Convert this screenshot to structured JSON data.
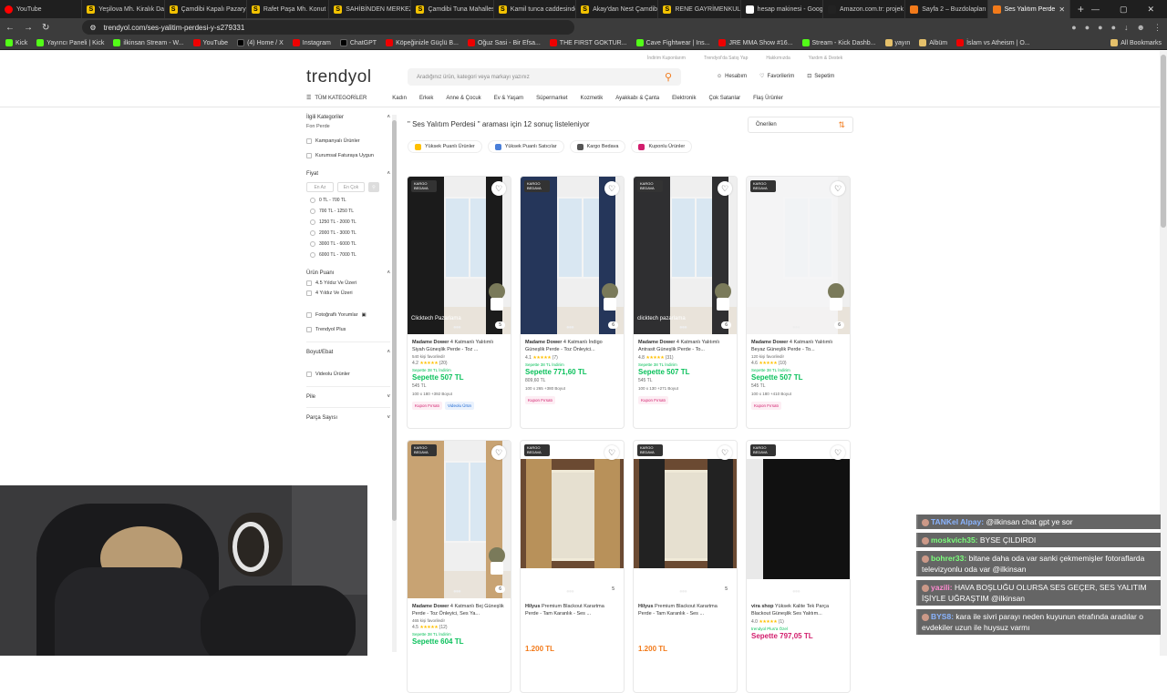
{
  "browser": {
    "tabs": [
      {
        "label": "YouTube",
        "type": "yt"
      },
      {
        "label": "Yeşilova Mh. Kiralık Daire",
        "type": "s"
      },
      {
        "label": "Çamdibi Kapalı Pazaryeri",
        "type": "s"
      },
      {
        "label": "Rafet Paşa Mh. Konut Fiy",
        "type": "s"
      },
      {
        "label": "SAHİBİNDEN MERKEZİ F",
        "type": "s"
      },
      {
        "label": "Çamdibi Tuna Mahallesi",
        "type": "s"
      },
      {
        "label": "Kamil tunca caddesinde",
        "type": "s"
      },
      {
        "label": "Akay'dan Nest Çamdibi",
        "type": "s"
      },
      {
        "label": "RENE GAYRİMENKULDE",
        "type": "s"
      },
      {
        "label": "hesap makinesi - Google",
        "type": "g"
      },
      {
        "label": "Amazon.com.tr: projek",
        "type": "a"
      },
      {
        "label": "Sayfa 2 – Buzdolapları",
        "type": "t"
      },
      {
        "label": "Ses Yalıtım Perde",
        "type": "t",
        "active": true
      }
    ],
    "url": "trendyol.com/ses-yalitim-perdesi-y-s279331",
    "bookmarks": [
      {
        "label": "Kick",
        "icon": "green"
      },
      {
        "label": "Yayıncı Paneli | Kick",
        "icon": "green"
      },
      {
        "label": "ilkinsan Stream - W...",
        "icon": "green"
      },
      {
        "label": "YouTube",
        "icon": "red"
      },
      {
        "label": "(4) Home / X",
        "icon": "x"
      },
      {
        "label": "Instagram",
        "icon": "red"
      },
      {
        "label": "ChatGPT",
        "icon": "x"
      },
      {
        "label": "Köpeğinizle Güçlü B...",
        "icon": "red"
      },
      {
        "label": "Oğuz Sasi - Bir Efsa...",
        "icon": "red"
      },
      {
        "label": "THE FIRST GOKTUR...",
        "icon": "red"
      },
      {
        "label": "Cave Fightwear | Ins...",
        "icon": "green"
      },
      {
        "label": "JRE MMA Show #16...",
        "icon": "red"
      },
      {
        "label": "Stream - Kick Dashb...",
        "icon": "green"
      },
      {
        "label": "yayın",
        "icon": "folder"
      },
      {
        "label": "Albüm",
        "icon": "folder"
      },
      {
        "label": "İslam vs Atheism | O...",
        "icon": "red"
      },
      {
        "label": "All Bookmarks",
        "icon": "folder"
      }
    ]
  },
  "site": {
    "logo": "trendyol",
    "top_links": [
      "İndirim Kuponlarım",
      "Trendyol'da Satış Yap",
      "Hakkımızda",
      "Yardım & Destek"
    ],
    "search_placeholder": "Aradığınız ürün, kategori veya markayı yazınız",
    "user_actions": [
      "Hesabım",
      "Favorilerim",
      "Sepetim"
    ],
    "all_categories": "TÜM KATEGORİLER",
    "categories": [
      "Kadın",
      "Erkek",
      "Anne & Çocuk",
      "Ev & Yaşam",
      "Süpermarket",
      "Kozmetik",
      "Ayakkabı & Çanta",
      "Elektronik",
      "Çok Satanlar",
      "Flaş Ürünler"
    ]
  },
  "filters": {
    "related_title": "İlgili Kategoriler",
    "related_item": "Fon Perde",
    "campaign": "Kampanyalı Ürünler",
    "corporate": "Kurumsal Faturaya Uygun",
    "price_title": "Fiyat",
    "min_placeholder": "En Az",
    "max_placeholder": "En Çok",
    "price_ranges": [
      "0 TL - 700 TL",
      "700 TL - 1250 TL",
      "1250 TL - 2000 TL",
      "2000 TL - 3000 TL",
      "3000 TL - 6000 TL",
      "6000 TL - 7000 TL"
    ],
    "rating_title": "Ürün Puanı",
    "rating_options": [
      "4.5 Yıldız Ve Üzeri",
      "4 Yıldız Ve Üzeri"
    ],
    "photo_reviews": "Fotoğraflı Yorumlar",
    "trendyol_plus": "Trendyol Plus",
    "size_title": "Boyut/Ebat",
    "video_products": "Videolu Ürünler",
    "pile": "Pile",
    "piece_count": "Parça Sayısı"
  },
  "results": {
    "text": "\" Ses Yalıtım Perdesi \" araması için 12 sonuç listeleniyor",
    "sort_label": "Önerilen",
    "chips": [
      {
        "label": "Yüksek Puanlı Ürünler",
        "color": "#ffc000"
      },
      {
        "label": "Yüksek Puanlı Satıcılar",
        "color": "#4a7fd9"
      },
      {
        "label": "Kargo Bedava",
        "color": "#555555"
      },
      {
        "label": "Kuponlu Ürünler",
        "color": "#d21e6d"
      }
    ]
  },
  "products": [
    {
      "badge": "KARGO BEDAVA",
      "brand": "Madame Dower",
      "name": "4 Katmanlı Yalıtımlı Siyah Güneşlik Perde - Toz ...",
      "fav": "540 kişi favoriledi!",
      "rating": "4.2",
      "reviews": "(20)",
      "promo": "Sepette 38 TL İndirim",
      "price": "Sepette 507 TL",
      "old": "545 TL",
      "size": "100 x 180 +392 Boyut",
      "tags": [
        "Kupon Fırsatı",
        "Videolu Ürün"
      ],
      "curtain": "#1b1b1b",
      "wm": "Clicktech Pazarlama",
      "photos": "5",
      "price_color": "green"
    },
    {
      "badge": "KARGO BEDAVA",
      "brand": "Madame Dower",
      "name": "4 Katmanlı İndigo Güneşlik Perde - Toz Önleyici...",
      "fav": "",
      "rating": "4.1",
      "reviews": "(7)",
      "promo": "Sepette 38 TL İndirim",
      "price": "Sepette 771,60 TL",
      "old": "809,60 TL",
      "size": "100 x 265 +380 Boyut",
      "tags": [
        "Kupon Fırsatı"
      ],
      "curtain": "#25365a",
      "wm": "",
      "photos": "6",
      "price_color": "green"
    },
    {
      "badge": "KARGO BEDAVA",
      "brand": "Madame Dower",
      "name": "4 Katmanlı Yalıtımlı Antrasit Güneşlik Perde - To...",
      "fav": "",
      "rating": "4.8",
      "reviews": "(31)",
      "promo": "Sepette 38 TL İndirim",
      "price": "Sepette 507 TL",
      "old": "545 TL",
      "size": "100 x 130 +271 Boyut",
      "tags": [
        "Kupon Fırsatı"
      ],
      "curtain": "#2f2f31",
      "wm": "clicktech pazarlama",
      "photos": "6",
      "price_color": "green"
    },
    {
      "badge": "KARGO BEDAVA",
      "brand": "Madame Dower",
      "name": "4 Katmanlı Yalıtımlı Beyaz Güneşlik Perde - To...",
      "fav": "120 kişi favoriledi!",
      "rating": "4.6",
      "reviews": "(10)",
      "promo": "Sepette 38 TL İndirim",
      "price": "Sepette 507 TL",
      "old": "545 TL",
      "size": "100 x 180 +410 Boyut",
      "tags": [
        "Kupon Fırsatı"
      ],
      "curtain": "#f4f4f6",
      "wm": "",
      "photos": "6",
      "price_color": "green"
    },
    {
      "badge": "KARGO BEDAVA",
      "brand": "Madame Dower",
      "name": "4 Katmanlı Bej Güneşlik Perde - Toz Önleyici, Ses Ya...",
      "fav": "465 kişi favoriledi!",
      "rating": "4.5",
      "reviews": "(12)",
      "promo": "Sepette 38 TL İndirim",
      "price": "Sepette 604 TL",
      "old": "",
      "size": "",
      "tags": [],
      "curtain": "#c8a373",
      "wm": "",
      "photos": "6",
      "price_color": "green"
    },
    {
      "badge": "KARGO BEDAVA",
      "brand": "Hilyus",
      "name": "Premium Blackout Karartma Perde - Tam Karanlık - Ses ...",
      "fav": "",
      "rating": "",
      "reviews": "",
      "promo": "",
      "price": "1.200 TL",
      "old": "",
      "size": "",
      "tags": [],
      "curtain": "#b8915a",
      "wm": "",
      "photos": "5",
      "price_color": "orange"
    },
    {
      "badge": "KARGO BEDAVA",
      "brand": "Hilyus",
      "name": "Premium Blackout Karartma Perde - Tam Karanlık - Ses ...",
      "fav": "",
      "rating": "",
      "reviews": "",
      "promo": "",
      "price": "1.200 TL",
      "old": "",
      "size": "",
      "tags": [],
      "curtain": "#222222",
      "wm": "",
      "photos": "5",
      "price_color": "orange"
    },
    {
      "badge": "KARGO BEDAVA",
      "brand": "vira shop",
      "name": "Yüksek Kalite Tek Parça Blackout Güneşlik Ses Yalıtım...",
      "fav": "",
      "rating": "4.0",
      "reviews": "(1)",
      "promo": "trendyol Plus'a Özel",
      "price": "Sepette 797,05 TL",
      "old": "",
      "size": "",
      "tags": [],
      "curtain": "#111111",
      "wm": "",
      "photos": "",
      "price_color": "pink"
    }
  ],
  "chat": [
    {
      "user": "TANKel Alpay:",
      "text": "@ilkinsan chat gpt ye sor",
      "color": "#8ab4ff"
    },
    {
      "user": "moskvich35:",
      "text": "BYSE ÇILDIRDI",
      "color": "#7cff7c"
    },
    {
      "user": "bohrer33:",
      "text": "bitane daha oda var sanki çekmemişler fotoraflarda televizyonlu oda var @ilkinsan",
      "color": "#7cff7c"
    },
    {
      "user": "yazili:",
      "text": "HAVA BOŞLUĞU OLURSA SES GEÇER, SES YALITIM İŞİYLE UĞRAŞTIM @ilkinsan",
      "color": "#ff8ad0"
    },
    {
      "user": "BYS8:",
      "text": "kara ile sivri parayı neden kuyunun etrafında aradılar o evdekiler uzun ile huysuz varmı",
      "color": "#8ab4ff"
    }
  ]
}
